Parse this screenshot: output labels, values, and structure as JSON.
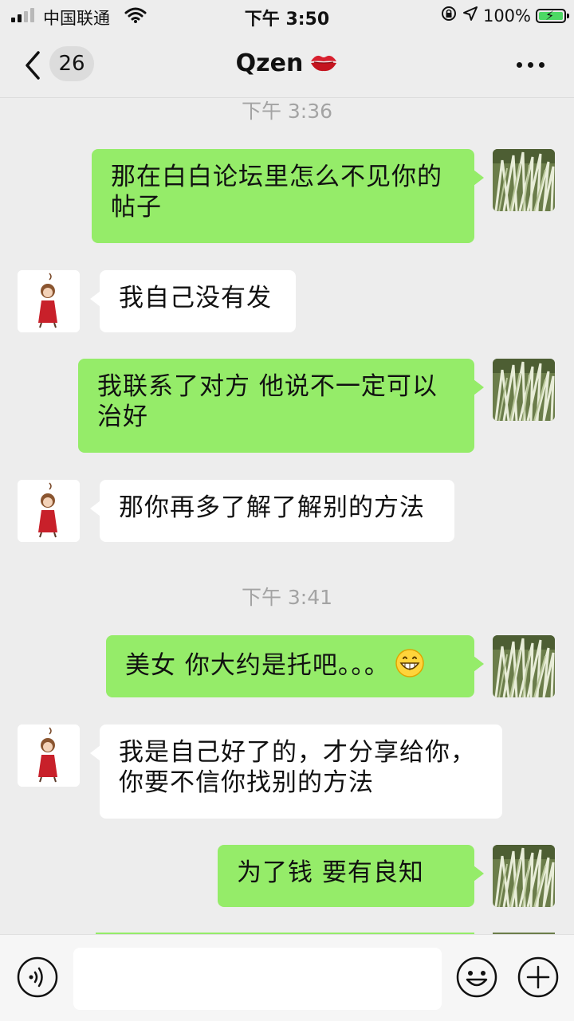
{
  "status_bar": {
    "carrier": "中国联通",
    "time": "下午 3:50",
    "battery": "100%",
    "signal_bars": 2,
    "battery_level": 1.0
  },
  "nav": {
    "unread_count": "26",
    "title": "Qzen"
  },
  "messages": [
    {
      "type": "time",
      "text": "下午 3:36"
    },
    {
      "side": "self",
      "lines": [
        "那在白白论坛里怎么不见你的",
        "帖子"
      ]
    },
    {
      "side": "other",
      "lines": [
        "我自己没有发"
      ]
    },
    {
      "side": "self",
      "lines": [
        "我联系了对方  他说不一定可以",
        "治好"
      ]
    },
    {
      "side": "other",
      "lines": [
        "那你再多了解了解别的方法"
      ]
    },
    {
      "type": "time",
      "text": "下午 3:41"
    },
    {
      "side": "self",
      "lines": [
        "美女  你大约是托吧。。。"
      ],
      "emoji": "grin"
    },
    {
      "side": "other",
      "lines": [
        "我是自己好了的，才分享给你，",
        "你要不信你找别的方法"
      ]
    },
    {
      "side": "self",
      "lines": [
        "为了钱   要有良知"
      ]
    }
  ],
  "colors": {
    "self_bubble": "#95ec69",
    "other_bubble": "#ffffff",
    "background": "#ededed",
    "battery": "#4cd964"
  },
  "icons": {
    "back": "chevron-left-icon",
    "more": "more-dots-icon",
    "voice": "voice-icon",
    "emoji": "emoji-icon",
    "plus": "plus-icon"
  }
}
